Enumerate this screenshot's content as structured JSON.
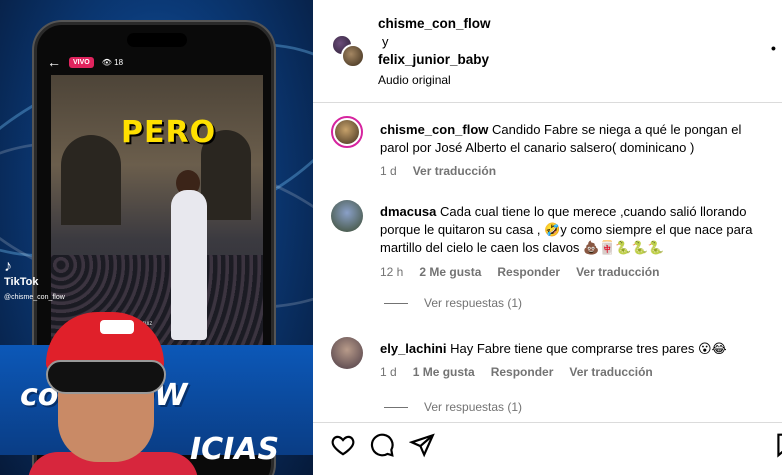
{
  "media": {
    "live_label": "VIVO",
    "viewer_count": "18",
    "overlay_word": "PERO",
    "stage_credit": "Benica Oliva Ruiz",
    "tiktok_label": "TikTok",
    "tiktok_handle": "@chisme_con_flow",
    "banner_title": "con FLOW",
    "banner_sub": "ICIAS"
  },
  "header": {
    "user_one": "chisme_con_flow",
    "connector": "y",
    "user_two": "felix_junior_baby",
    "audio": "Audio original",
    "more_icon": "more-horizontal-icon"
  },
  "comments": [
    {
      "user": "chisme_con_flow",
      "text": "Candido Fabre se niega a qué le pongan el parol por José Alberto el canario salsero( dominicano )",
      "time": "1 d",
      "translate": "Ver traducción"
    },
    {
      "user": "dmacusa",
      "text": "Cada cual tiene lo que merece ,cuando salió llorando porque le quitaron su casa , 🤣y como siempre el que nace para martillo del cielo le caen los clavos 💩🀄🐍🐍🐍",
      "time": "12 h",
      "likes": "2 Me gusta",
      "reply": "Responder",
      "translate": "Ver traducción",
      "view_replies": "Ver respuestas (1)"
    },
    {
      "user": "ely_lachini",
      "text": "Hay Fabre tiene que comprarse tres pares 😮😂",
      "time": "1 d",
      "likes": "1 Me gusta",
      "reply": "Responder",
      "translate": "Ver traducción",
      "view_replies": "Ver respuestas (1)"
    }
  ],
  "actions": {
    "like_icon": "heart-icon",
    "comment_icon": "comment-icon",
    "share_icon": "send-icon",
    "save_icon": "bookmark-icon"
  },
  "colors": {
    "meta_gray": "#737373",
    "divider": "#dbdbdb",
    "story_ring": "#d6249f"
  }
}
